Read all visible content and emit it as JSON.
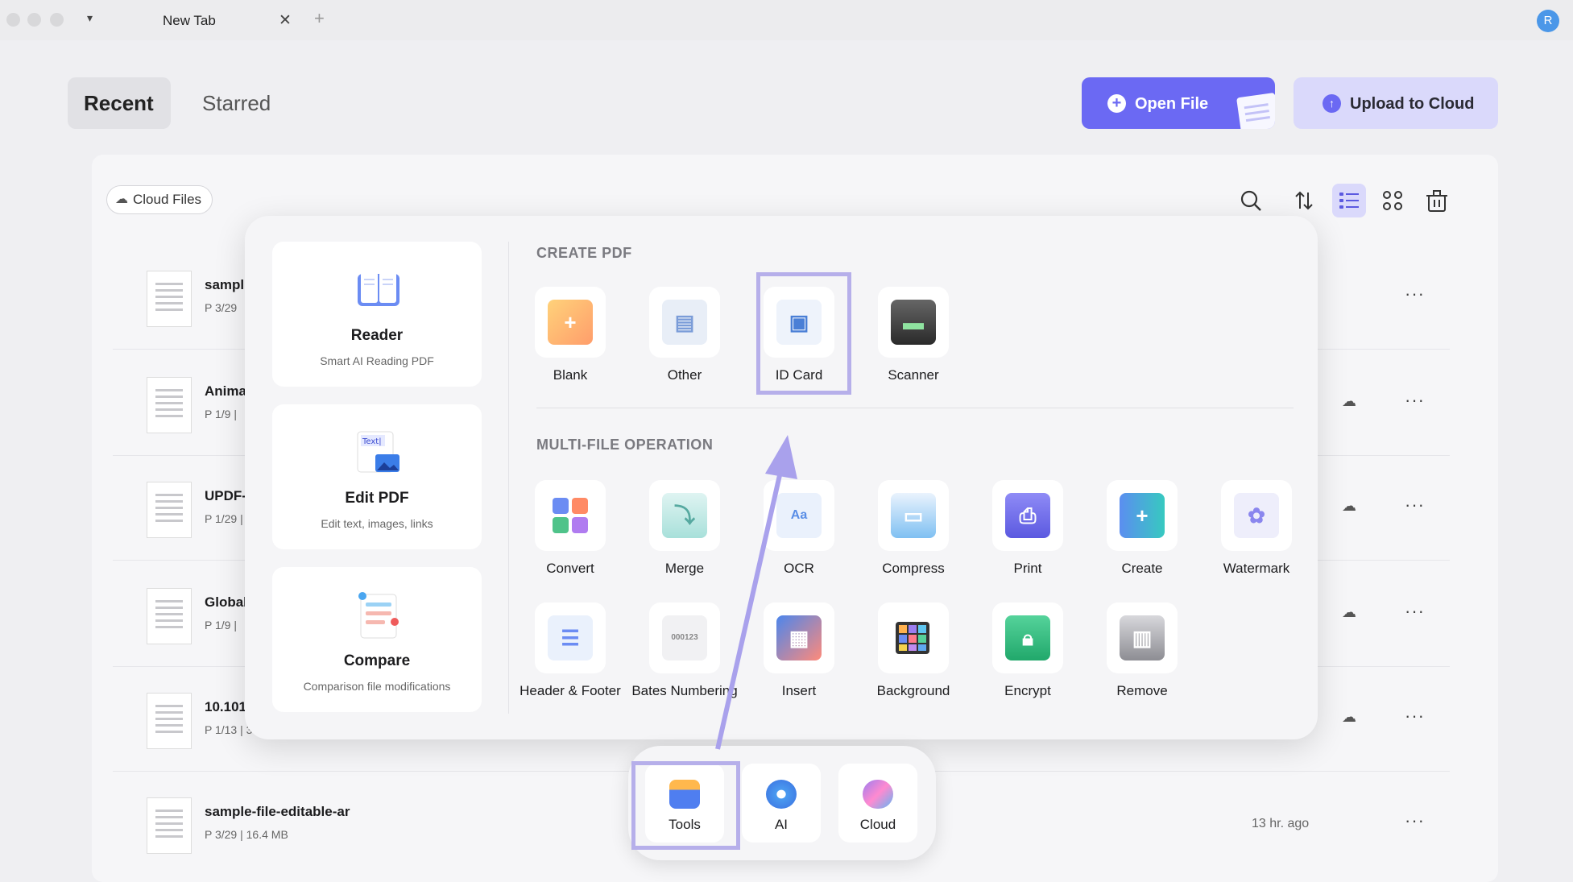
{
  "browser": {
    "tab_title": "New Tab",
    "close_glyph": "✕",
    "new_tab_glyph": "+",
    "dropdown_glyph": "▾",
    "user_initial": "R"
  },
  "header": {
    "tabs": {
      "recent": "Recent",
      "starred": "Starred"
    },
    "open_file_label": "Open File",
    "upload_label": "Upload to Cloud"
  },
  "toolbar": {
    "cloud_files_label": "Cloud Files",
    "icons": [
      "search-icon",
      "sort-icon",
      "list-view-icon",
      "grid-view-icon",
      "trash-icon"
    ]
  },
  "files": [
    {
      "name": "sampl",
      "meta": "P 3/29",
      "time": "",
      "cloud": false
    },
    {
      "name": "Anima",
      "meta": "P 1/9  |",
      "time": "",
      "cloud": true
    },
    {
      "name": "UPDF-",
      "meta": "P 1/29  |",
      "time": "",
      "cloud": true
    },
    {
      "name": "Global",
      "meta": "P 1/9  |",
      "time": "",
      "cloud": true
    },
    {
      "name": "10.101",
      "meta": "P 1/13  |  3.",
      "time": "",
      "cloud": true
    },
    {
      "name": "sample-file-editable-ar",
      "meta": "P 3/29  |  16.4 MB",
      "time": "13 hr. ago",
      "cloud": false
    }
  ],
  "popup": {
    "side_cards": [
      {
        "title": "Reader",
        "desc": "Smart AI Reading PDF",
        "icon": "book-icon"
      },
      {
        "title": "Edit PDF",
        "desc": "Edit text, images, links",
        "icon": "edit-text-icon"
      },
      {
        "title": "Compare",
        "desc": "Comparison file modifications",
        "icon": "compare-icon"
      }
    ],
    "create_section": "CREATE PDF",
    "create_tools": [
      "Blank",
      "Other",
      "ID Card",
      "Scanner"
    ],
    "multi_section": "MULTI-FILE OPERATION",
    "multi_tools_row1": [
      "Convert",
      "Merge",
      "OCR",
      "Compress",
      "Print",
      "Create",
      "Watermark"
    ],
    "multi_tools_row2": [
      "Header & Footer",
      "Bates Numbering",
      "Insert",
      "Background",
      "Encrypt",
      "Remove"
    ],
    "edit_icon_text": "Text|",
    "ocr_icon_text": "Aa",
    "bates_icon_text": "000123"
  },
  "dock": {
    "items": [
      "Tools",
      "AI",
      "Cloud"
    ]
  },
  "colors": {
    "accent": "#6b69f3",
    "accent_light": "#dad9fb",
    "highlight_border": "#b6afea",
    "arrow": "#a9a1ec"
  }
}
